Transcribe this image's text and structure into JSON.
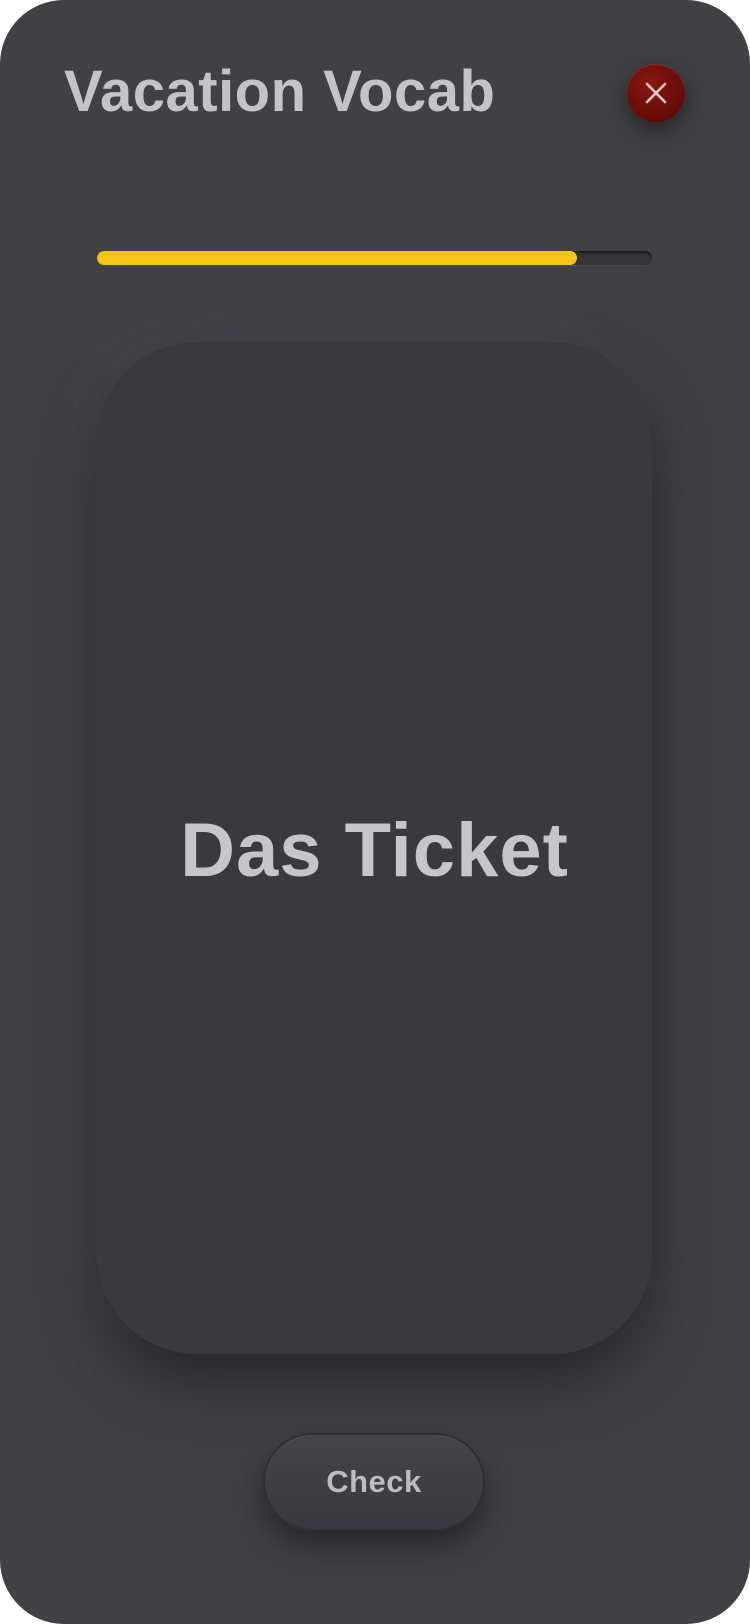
{
  "header": {
    "title": "Vacation Vocab",
    "close_icon": "close-icon"
  },
  "progress": {
    "fraction": 0.865,
    "color": "#f5c518"
  },
  "card": {
    "word": "Das Ticket"
  },
  "actions": {
    "check_label": "Check"
  },
  "colors": {
    "background": "#404045",
    "card": "#39393e",
    "close_button": "#6a0c09",
    "text": "#c4c4c6"
  }
}
